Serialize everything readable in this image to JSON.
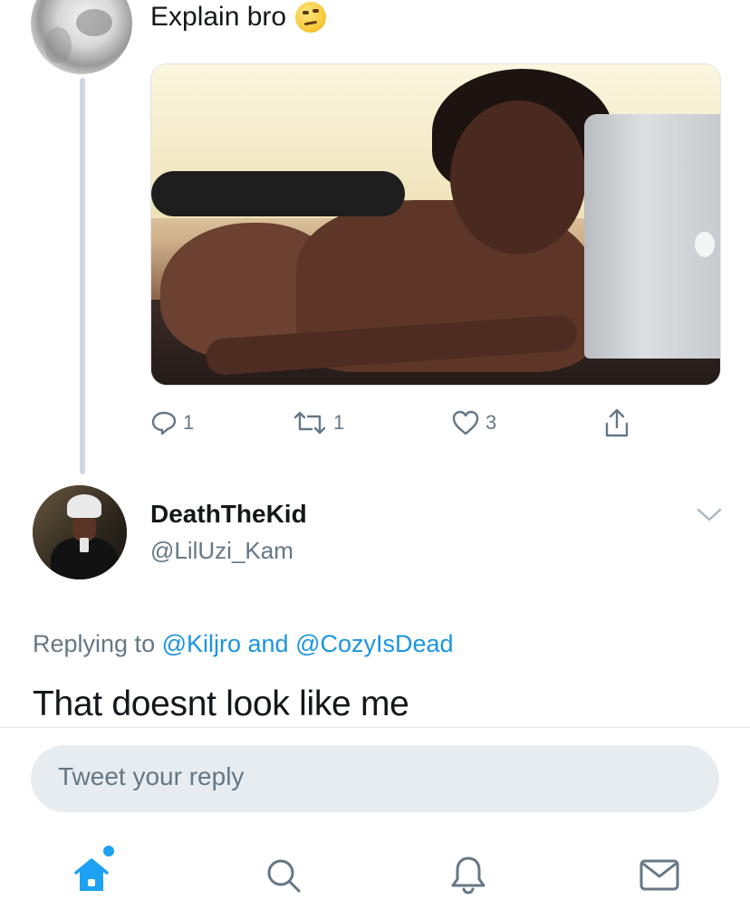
{
  "parent_tweet": {
    "text": "Explain bro",
    "emoji": "raised-eyebrow-emoji",
    "actions": {
      "reply_count": "1",
      "retweet_count": "1",
      "like_count": "3"
    }
  },
  "reply_tweet": {
    "display_name": "DeathTheKid",
    "handle": "@LilUzi_Kam",
    "replying_prefix": "Replying to ",
    "replying_user1": "@Kiljro",
    "replying_and": " and ",
    "replying_user2": "@CozyIsDead",
    "body": "That doesnt look like me"
  },
  "composer": {
    "placeholder": "Tweet your reply"
  },
  "bottom_nav": {
    "items": [
      "home-icon",
      "search-icon",
      "notifications-icon",
      "messages-icon"
    ]
  },
  "colors": {
    "accent": "#1da1f2",
    "link": "#1b95e0",
    "secondary_text": "#657786",
    "composer_bg": "#e6ecf0"
  }
}
